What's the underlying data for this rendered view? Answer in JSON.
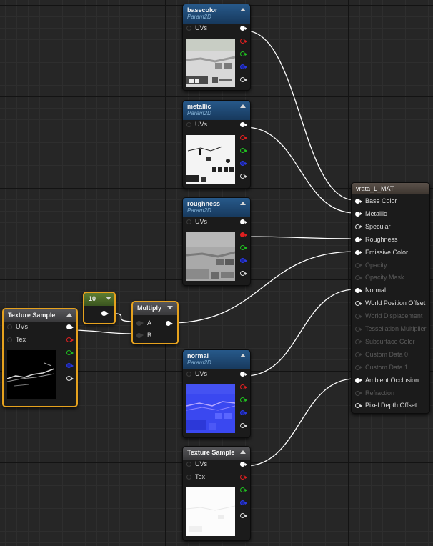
{
  "graph": {
    "nodes": {
      "basecolor": {
        "title": "basecolor",
        "subtitle": "Param2D",
        "uvs_label": "UVs"
      },
      "metallic": {
        "title": "metallic",
        "subtitle": "Param2D",
        "uvs_label": "UVs"
      },
      "roughness": {
        "title": "roughness",
        "subtitle": "Param2D",
        "uvs_label": "UVs"
      },
      "normal": {
        "title": "normal",
        "subtitle": "Param2D",
        "uvs_label": "UVs"
      },
      "texture_sample_left": {
        "title": "Texture Sample",
        "uvs_label": "UVs",
        "tex_label": "Tex"
      },
      "texture_sample_bottom": {
        "title": "Texture Sample",
        "uvs_label": "UVs",
        "tex_label": "Tex"
      },
      "constant": {
        "value": "10"
      },
      "multiply": {
        "title": "Multiply",
        "a_label": "A",
        "b_label": "B"
      },
      "material": {
        "title": "vrata_L_MAT",
        "inputs": [
          {
            "label": "Base Color",
            "state": "connected"
          },
          {
            "label": "Metallic",
            "state": "connected"
          },
          {
            "label": "Specular",
            "state": "enabled"
          },
          {
            "label": "Roughness",
            "state": "connected"
          },
          {
            "label": "Emissive Color",
            "state": "connected"
          },
          {
            "label": "Opacity",
            "state": "disabled"
          },
          {
            "label": "Opacity Mask",
            "state": "disabled"
          },
          {
            "label": "Normal",
            "state": "connected"
          },
          {
            "label": "World Position Offset",
            "state": "enabled"
          },
          {
            "label": "World Displacement",
            "state": "disabled"
          },
          {
            "label": "Tessellation Multiplier",
            "state": "disabled"
          },
          {
            "label": "Subsurface Color",
            "state": "disabled"
          },
          {
            "label": "Custom Data 0",
            "state": "disabled"
          },
          {
            "label": "Custom Data 1",
            "state": "disabled"
          },
          {
            "label": "Ambient Occlusion",
            "state": "connected"
          },
          {
            "label": "Refraction",
            "state": "disabled"
          },
          {
            "label": "Pixel Depth Offset",
            "state": "enabled"
          }
        ]
      }
    },
    "colors": {
      "background": "#262626",
      "texture_header": "#27598a",
      "material_header": "#5b514a",
      "constant_header": "#5e7d32",
      "selection_outline": "#e6a21e",
      "wire": "#ffffff"
    },
    "icons": [
      "collapse-arrow-icon",
      "pin-icon"
    ]
  }
}
